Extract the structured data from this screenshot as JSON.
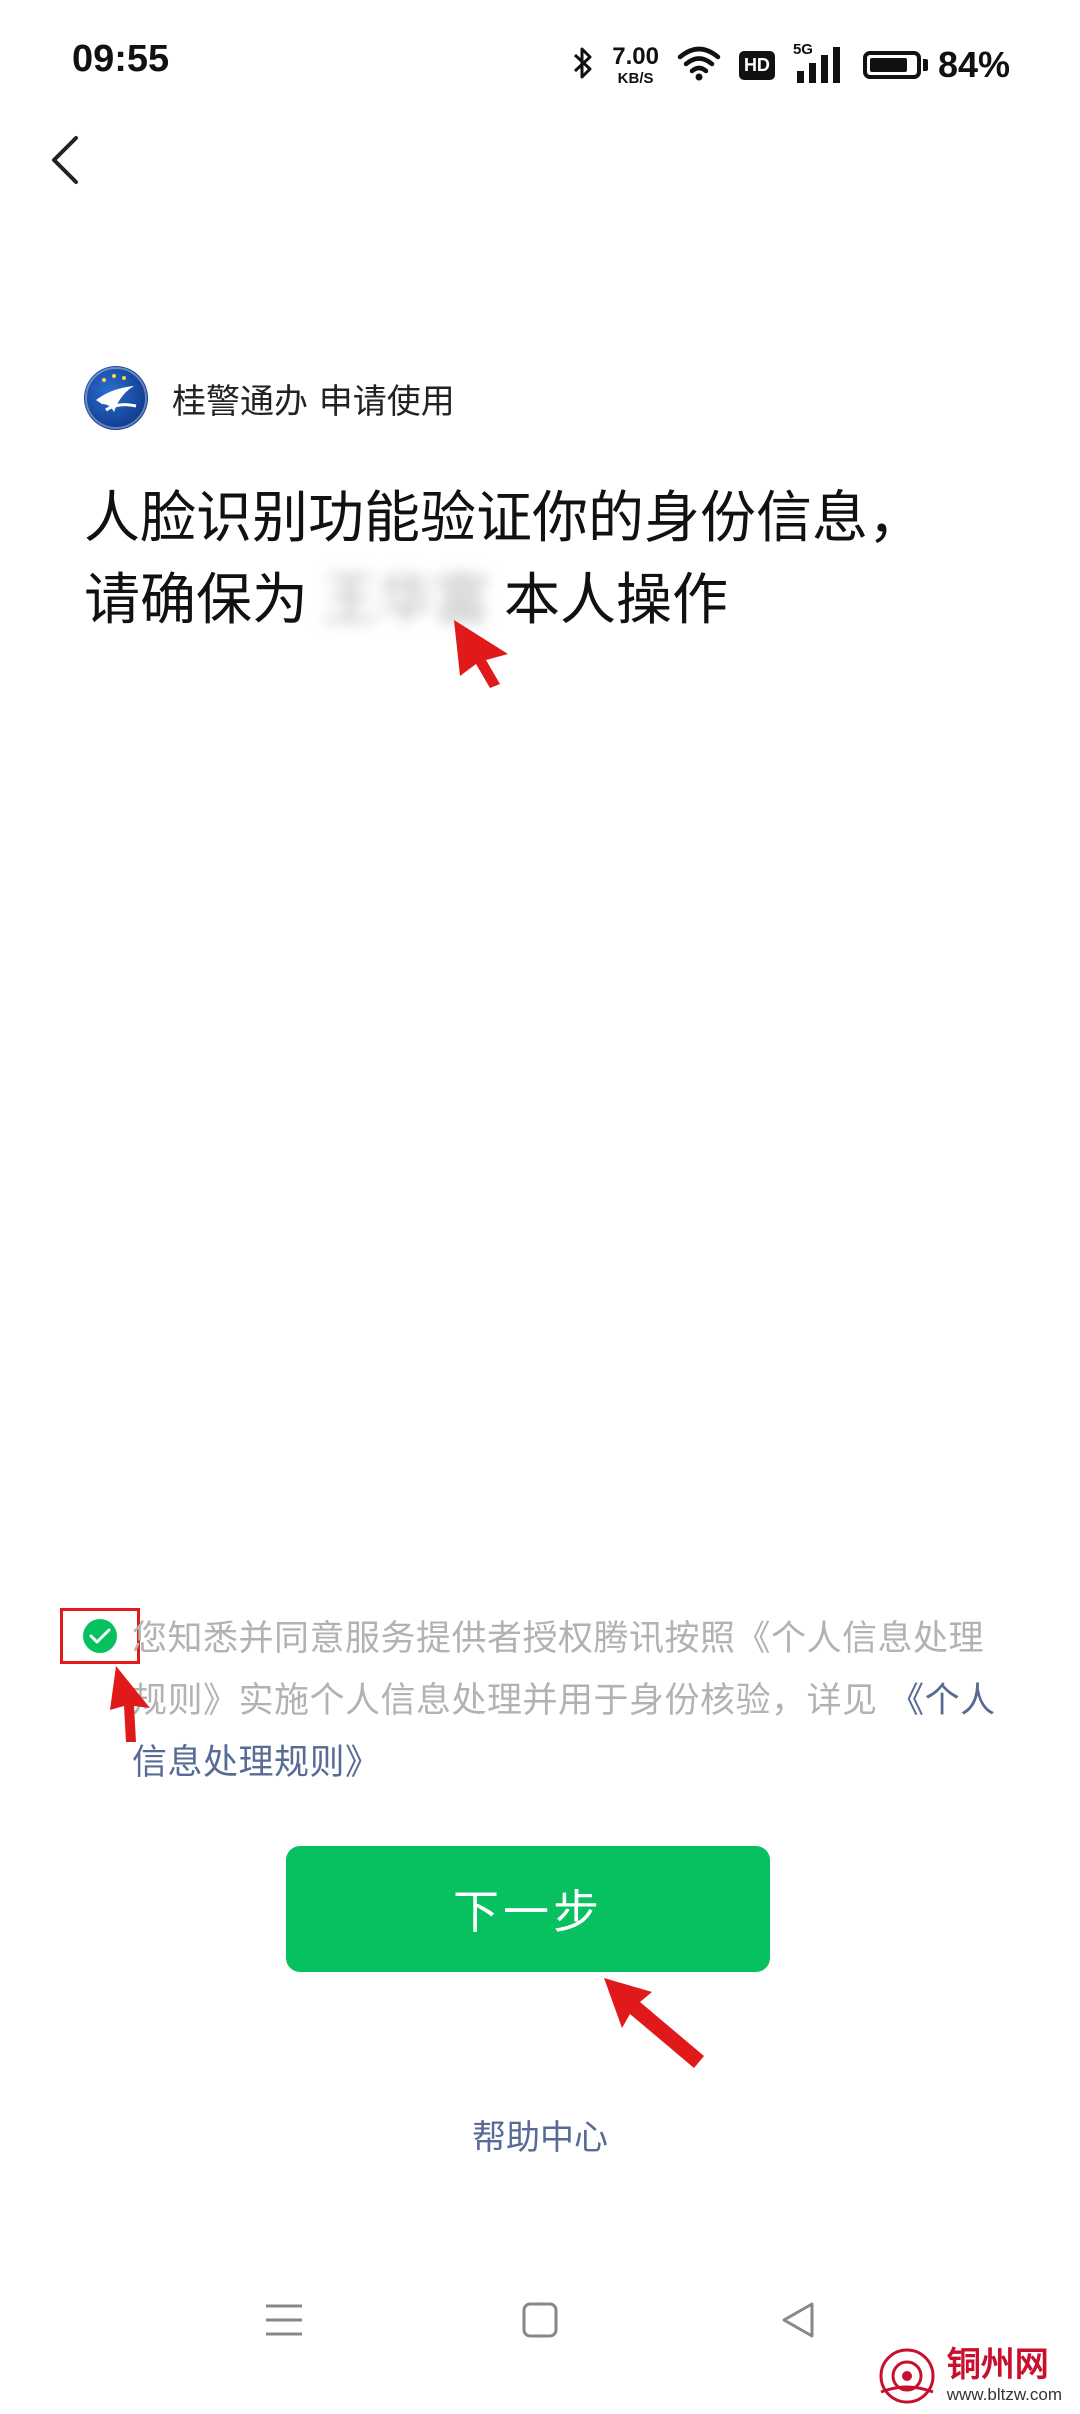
{
  "status_bar": {
    "time": "09:55",
    "net_speed_value": "7.00",
    "net_speed_unit": "KB/S",
    "hd_label": "HD",
    "signal_label": "5G",
    "battery_percent": "84%",
    "battery_level": 0.84,
    "icons": [
      "bluetooth-icon",
      "wifi-icon",
      "hd-icon",
      "signal-5g-icon",
      "battery-icon"
    ]
  },
  "header": {
    "back_icon": "chevron-left-icon"
  },
  "app": {
    "name": "桂警通办 申请使用",
    "logo_icon": "police-app-logo"
  },
  "headline": {
    "line1": "人脸识别功能验证你的身份信息，",
    "line2_prefix": "请确保为",
    "masked_name": "王华富",
    "line2_suffix": "本人操作"
  },
  "consent": {
    "checked": true,
    "text": "您知悉并同意服务提供者授权腾讯按照《个人信息处理规则》实施个人信息处理并用于身份核验，详见",
    "link_text": "《个人信息处理规则》"
  },
  "actions": {
    "next_label": "下一步",
    "help_label": "帮助中心"
  },
  "nav_bar": {
    "icons": [
      "menu-icon",
      "home-square-icon",
      "back-triangle-icon"
    ]
  },
  "colors": {
    "primary_green": "#07c160",
    "link_blue": "#576b95",
    "annotation_red": "#e01a1a"
  },
  "watermark": {
    "title": "铜州网",
    "url": "www.bltzw.com"
  }
}
